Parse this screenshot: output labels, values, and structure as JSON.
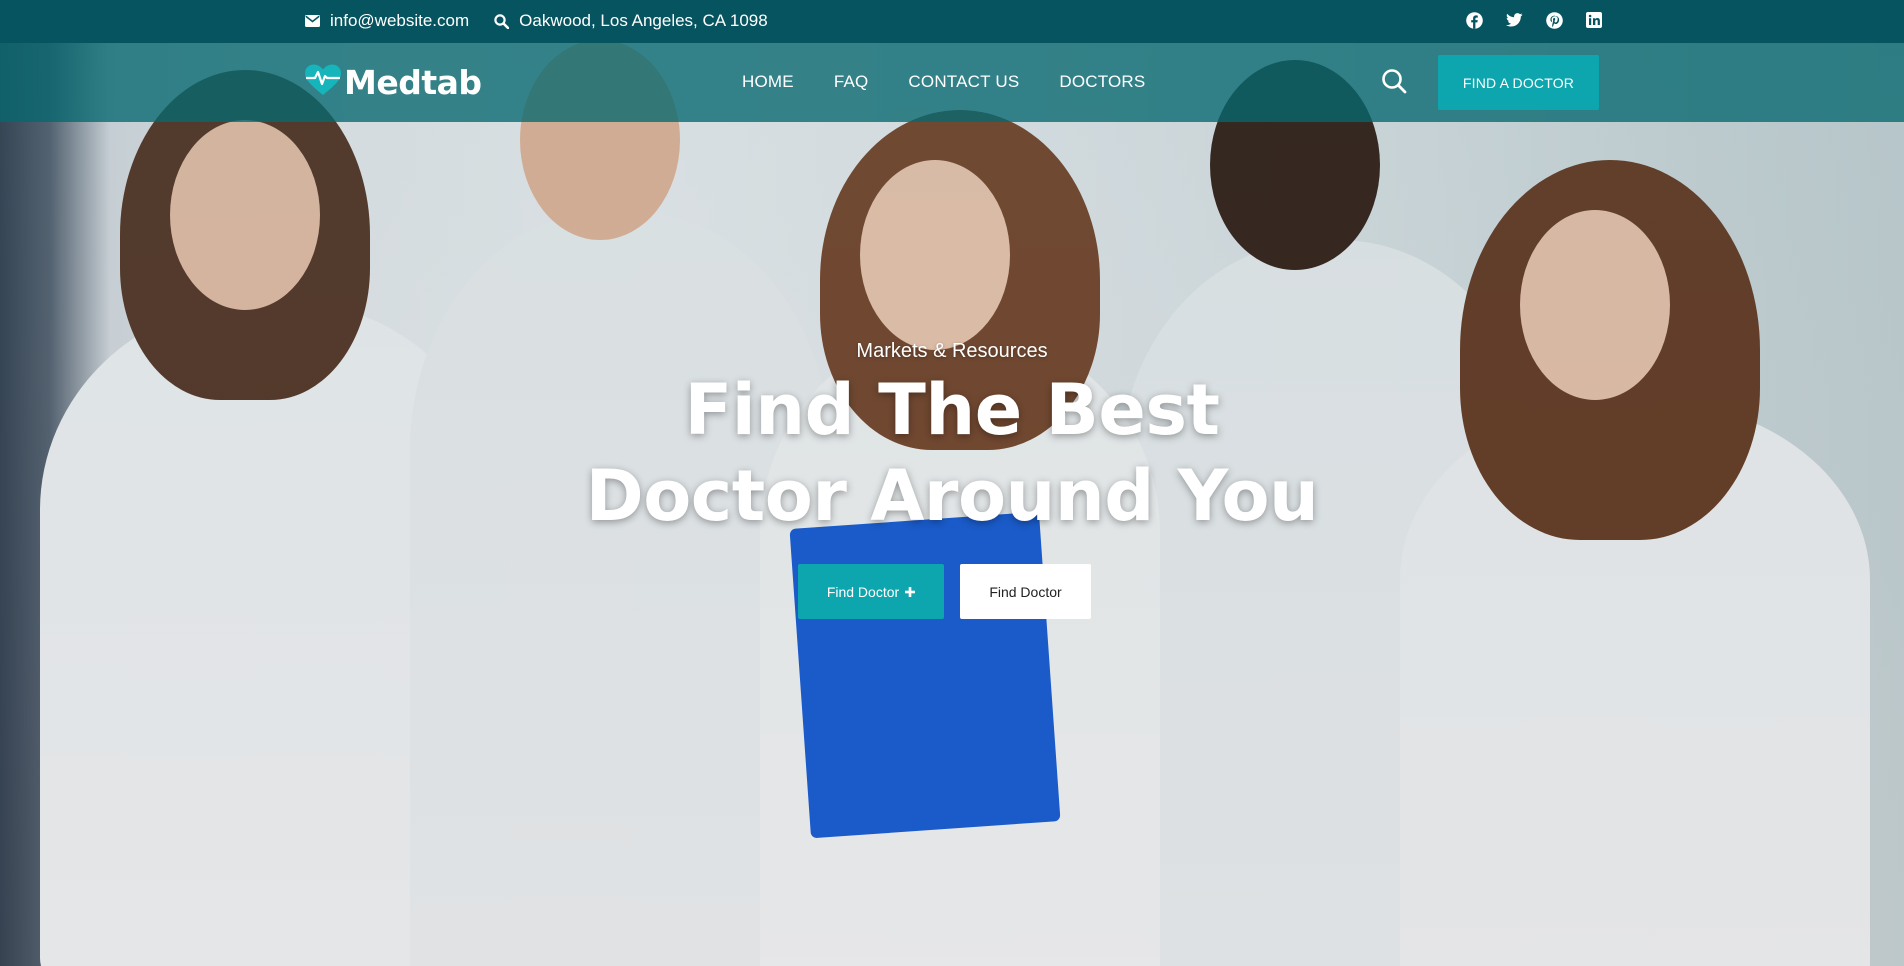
{
  "topbar": {
    "email": "info@website.com",
    "address": "Oakwood, Los Angeles, CA 1098",
    "social": [
      "facebook-icon",
      "twitter-icon",
      "pinterest-icon",
      "linkedin-icon"
    ]
  },
  "header": {
    "logo_text": "Medtab",
    "nav": [
      {
        "label": "HOME"
      },
      {
        "label": "FAQ"
      },
      {
        "label": "CONTACT US"
      },
      {
        "label": "DOCTORS"
      }
    ],
    "cta_label": "FIND A DOCTOR"
  },
  "hero": {
    "subtitle": "Markets & Resources",
    "title_line1": "Find The Best",
    "title_line2": "Doctor Around You",
    "primary_button": "Find Doctor",
    "secondary_button": "Find Doctor"
  },
  "colors": {
    "topbar_bg": "#06545f",
    "navbar_bg": "#066870",
    "accent": "#0ea6ae",
    "text_light": "#ffffff"
  }
}
